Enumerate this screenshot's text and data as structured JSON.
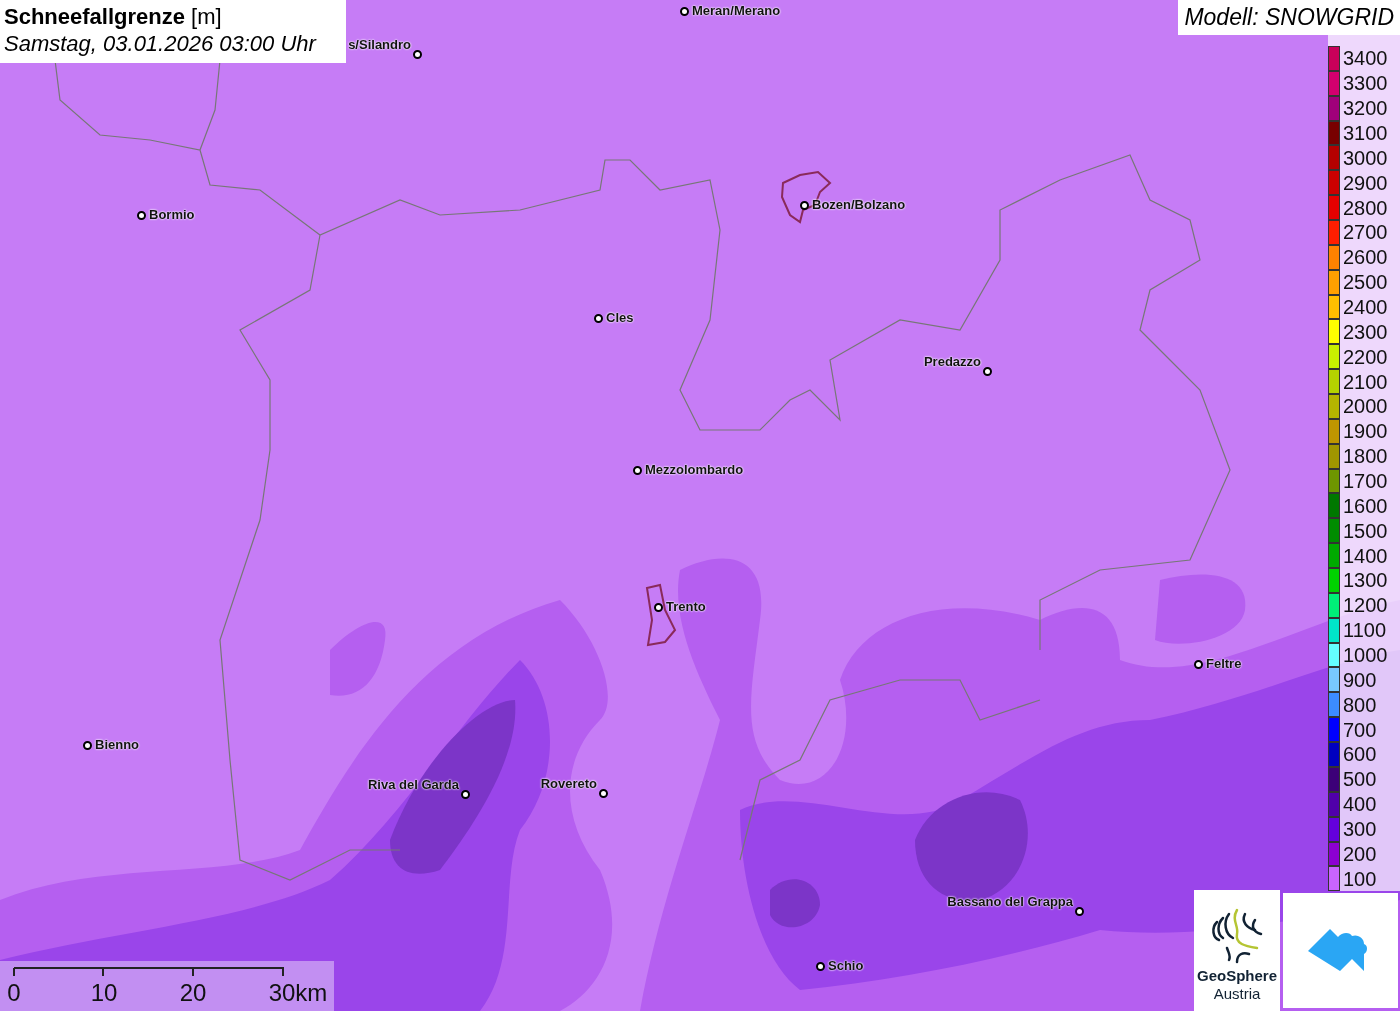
{
  "title": {
    "heading": "**Schneefallgrenze** [m]",
    "subtitle": "Samstag, 03.01.2026 03:00 Uhr"
  },
  "model": "Modell: SNOWGRID",
  "cities": [
    {
      "name": "Meran/Merano"
    },
    {
      "name": "s/Silandro"
    },
    {
      "name": "Bormio"
    },
    {
      "name": "Bozen/Bolzano"
    },
    {
      "name": "Cles"
    },
    {
      "name": "Predazzo"
    },
    {
      "name": "Mezzolombardo"
    },
    {
      "name": "Trento"
    },
    {
      "name": "Feltre"
    },
    {
      "name": "Bienno"
    },
    {
      "name": "Riva del Garda"
    },
    {
      "name": "Rovereto"
    },
    {
      "name": "Bassano del Grappa"
    },
    {
      "name": "Schio"
    }
  ],
  "legend": [
    {
      "label": "3400",
      "color": "#c8005a"
    },
    {
      "label": "3300",
      "color": "#d2006e"
    },
    {
      "label": "3200",
      "color": "#a0007a"
    },
    {
      "label": "3100",
      "color": "#780000"
    },
    {
      "label": "3000",
      "color": "#b40000"
    },
    {
      "label": "2900",
      "color": "#cc0000"
    },
    {
      "label": "2800",
      "color": "#e60000"
    },
    {
      "label": "2700",
      "color": "#ff1e00"
    },
    {
      "label": "2600",
      "color": "#ff8200"
    },
    {
      "label": "2500",
      "color": "#ffa000"
    },
    {
      "label": "2400",
      "color": "#ffbe00"
    },
    {
      "label": "2300",
      "color": "#ffff00"
    },
    {
      "label": "2200",
      "color": "#c8f000"
    },
    {
      "label": "2100",
      "color": "#b4d200"
    },
    {
      "label": "2000",
      "color": "#b4b400"
    },
    {
      "label": "1900",
      "color": "#be9600"
    },
    {
      "label": "1800",
      "color": "#a09600"
    },
    {
      "label": "1700",
      "color": "#6e9600"
    },
    {
      "label": "1600",
      "color": "#007800"
    },
    {
      "label": "1500",
      "color": "#008c00"
    },
    {
      "label": "1400",
      "color": "#00aa00"
    },
    {
      "label": "1300",
      "color": "#00d200"
    },
    {
      "label": "1200",
      "color": "#00f078"
    },
    {
      "label": "1100",
      "color": "#00e6c8"
    },
    {
      "label": "1000",
      "color": "#64ffff"
    },
    {
      "label": "900",
      "color": "#78c8ff"
    },
    {
      "label": "800",
      "color": "#3c8cff"
    },
    {
      "label": "700",
      "color": "#0000ff"
    },
    {
      "label": "600",
      "color": "#0000c0"
    },
    {
      "label": "500",
      "color": "#3c0078"
    },
    {
      "label": "400",
      "color": "#5000aa"
    },
    {
      "label": "300",
      "color": "#6400dc"
    },
    {
      "label": "200",
      "color": "#8c00d2"
    },
    {
      "label": "100",
      "color": "#c864ff"
    }
  ],
  "scale_bar": [
    "0",
    "10",
    "20",
    "30km"
  ],
  "logos": {
    "geosphere_name": "GeoSphere",
    "geosphere_country": "Austria"
  }
}
